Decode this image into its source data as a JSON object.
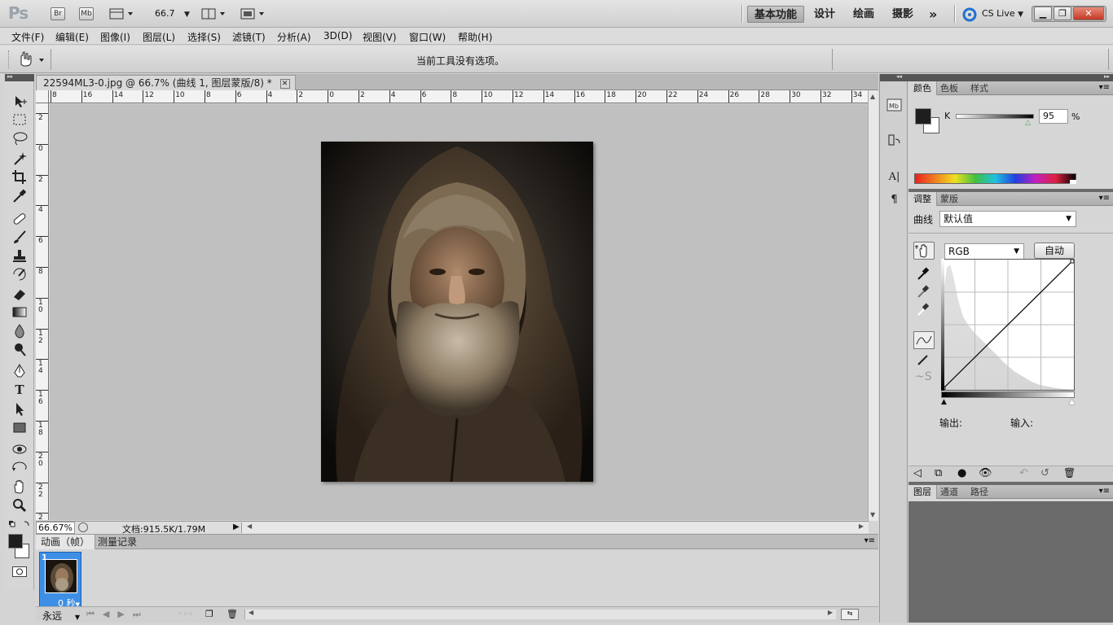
{
  "app": {
    "logo": "Ps",
    "bridge_label": "Br",
    "minibridge_label": "Mb",
    "zoom_value": "66.7",
    "workspaces": [
      "基本功能",
      "设计",
      "绘画",
      "摄影"
    ],
    "more_label": "»",
    "cs_live": "CS Live"
  },
  "menu": [
    "文件(F)",
    "编辑(E)",
    "图像(I)",
    "图层(L)",
    "选择(S)",
    "滤镜(T)",
    "分析(A)",
    "3D(D)",
    "视图(V)",
    "窗口(W)",
    "帮助(H)"
  ],
  "options_bar": {
    "message": "当前工具没有选项。"
  },
  "document": {
    "tab_title": "22594ML3-0.jpg @ 66.7% (曲线 1, 图层蒙版/8) *",
    "ruler_h": [
      "8",
      "16",
      "14",
      "12",
      "10",
      "8",
      "6",
      "4",
      "2",
      "0",
      "2",
      "4",
      "6",
      "8",
      "10",
      "12",
      "14",
      "16",
      "18",
      "20",
      "22",
      "24",
      "26",
      "28",
      "30",
      "32",
      "34"
    ],
    "ruler_v": [
      "2",
      "0",
      "2",
      "4",
      "6",
      "8",
      "1\n0",
      "1\n2",
      "1\n4",
      "1\n6",
      "1\n8",
      "2\n0",
      "2\n2",
      "2"
    ],
    "status_zoom": "66.67%",
    "status_doc": "文档:915.5K/1.79M"
  },
  "animation_panel": {
    "tabs": [
      "动画（帧）",
      "测量记录"
    ],
    "frame_number": "1",
    "frame_delay": "0 秒",
    "loop": "永远"
  },
  "color_panel": {
    "tabs": [
      "颜色",
      "色板",
      "样式"
    ],
    "channel_label": "K",
    "channel_value": "95",
    "percent_label": "%",
    "fg_color": "#1e1e1e",
    "bg_color": "#ffffff"
  },
  "adjust_panel": {
    "tabs": [
      "调整",
      "蒙版"
    ],
    "curves_label": "曲线",
    "preset_value": "默认值",
    "channel_value": "RGB",
    "auto_label": "自动",
    "output_label": "输出:",
    "input_label": "输入:"
  },
  "layers_panel": {
    "tabs": [
      "图层",
      "通道",
      "路径"
    ]
  }
}
